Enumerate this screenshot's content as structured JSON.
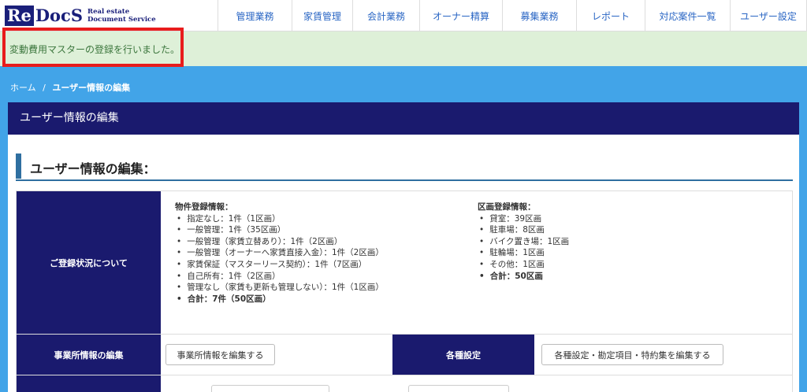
{
  "logo": {
    "re": "Re",
    "docs": "DocS",
    "sub1": "Real estate",
    "sub2": "Document Service"
  },
  "nav": {
    "items": [
      {
        "label": "管理業務"
      },
      {
        "label": "家賃管理"
      },
      {
        "label": "会計業務"
      },
      {
        "label": "オーナー精算"
      },
      {
        "label": "募集業務"
      },
      {
        "label": "レポート"
      },
      {
        "label": "対応案件一覧"
      },
      {
        "label": "ユーザー設定"
      }
    ]
  },
  "alert": {
    "message": "変動費用マスターの登録を行いました。"
  },
  "breadcrumb": {
    "home": "ホーム",
    "sep": "/",
    "current": "ユーザー情報の編集"
  },
  "panel": {
    "title": "ユーザー情報の編集"
  },
  "section": {
    "title": "ユーザー情報の編集："
  },
  "registration": {
    "label": "ご登録状況について",
    "property": {
      "heading": "物件登録情報：",
      "items": [
        "指定なし：1件（1区画）",
        "一般管理：1件（35区画）",
        "一般管理（家賃立替あり）：1件（2区画）",
        "一般管理（オーナーへ家賃直接入金）：1件（2区画）",
        "家賃保証（マスターリース契約）：1件（7区画）",
        "自己所有：1件（2区画）",
        "管理なし（家賃も更新も管理しない）：1件（1区画）"
      ],
      "total": "合計：7件（50区画）"
    },
    "unit": {
      "heading": "区画登録情報：",
      "items": [
        "貸室：39区画",
        "駐車場：8区画",
        "バイク置き場：1区画",
        "駐輪場：1区画",
        "その他：1区画"
      ],
      "total": "合計：50区画"
    }
  },
  "office": {
    "label": "事業所情報の編集",
    "button": "事業所情報を編集する"
  },
  "settings": {
    "label": "各種設定",
    "button": "各種設定・勘定項目・特約集を編集する"
  }
}
